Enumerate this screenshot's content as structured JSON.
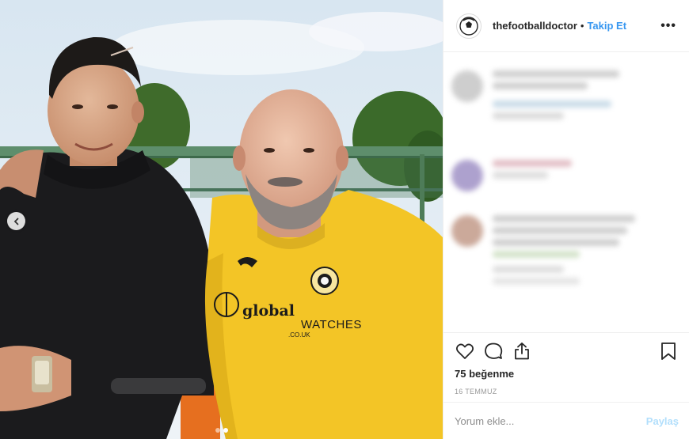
{
  "post": {
    "username": "thefootballdoctor",
    "separator": "•",
    "follow_label": "Takip Et",
    "more_label": "•••",
    "likes_text": "75 beğenme",
    "date_text": "16 TEMMUZ",
    "comment_placeholder": "Yorum ekle...",
    "share_label": "Paylaş"
  },
  "photo": {
    "shirt_logo_text": "global",
    "shirt_sponsor_text": "WATCHES",
    "shirt_sub_text": ".CO.UK",
    "carousel": {
      "slide_count": 2,
      "active_index": 1
    }
  },
  "icons": [
    "chevron-left-icon",
    "heart-icon",
    "comment-icon",
    "share-icon",
    "bookmark-icon",
    "more-options-icon"
  ],
  "colors": {
    "accent": "#3897f0",
    "share_disabled": "#b2dffc",
    "shirt": "#f3c526",
    "sky": "#dfe9f2"
  }
}
